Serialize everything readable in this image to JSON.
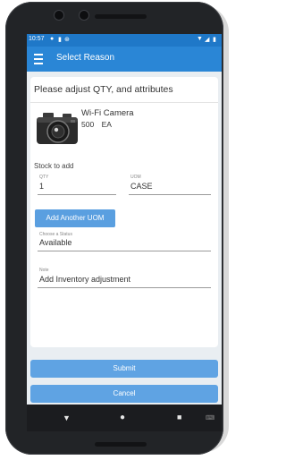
{
  "status_bar": {
    "time": "10:57",
    "left_icons": [
      "notification-icon",
      "sim-icon",
      "sync-icon"
    ],
    "right_icons": [
      "wifi-icon",
      "signal-icon",
      "battery-icon"
    ]
  },
  "app_bar": {
    "title": "Select Reason"
  },
  "card": {
    "heading": "Please adjust QTY, and attributes",
    "product": {
      "name": "Wi-Fi Camera",
      "quantity": "500",
      "unit": "EA"
    },
    "stock_label": "Stock to add",
    "qty_field": {
      "label": "QTY",
      "value": "1"
    },
    "uom_field": {
      "label": "UOM",
      "value": "CASE"
    },
    "add_uom_button": "Add Another UOM",
    "status_field": {
      "label": "Choose a Status",
      "value": "Available"
    },
    "note_field": {
      "label": "Note",
      "value": "Add Inventory adjustment"
    }
  },
  "actions": {
    "submit": "Submit",
    "cancel": "Cancel"
  },
  "colors": {
    "status_bar": "#1f78c8",
    "app_bar": "#2a86d6",
    "button": "#5fa3e3",
    "screen_background": "#e9eef2"
  }
}
